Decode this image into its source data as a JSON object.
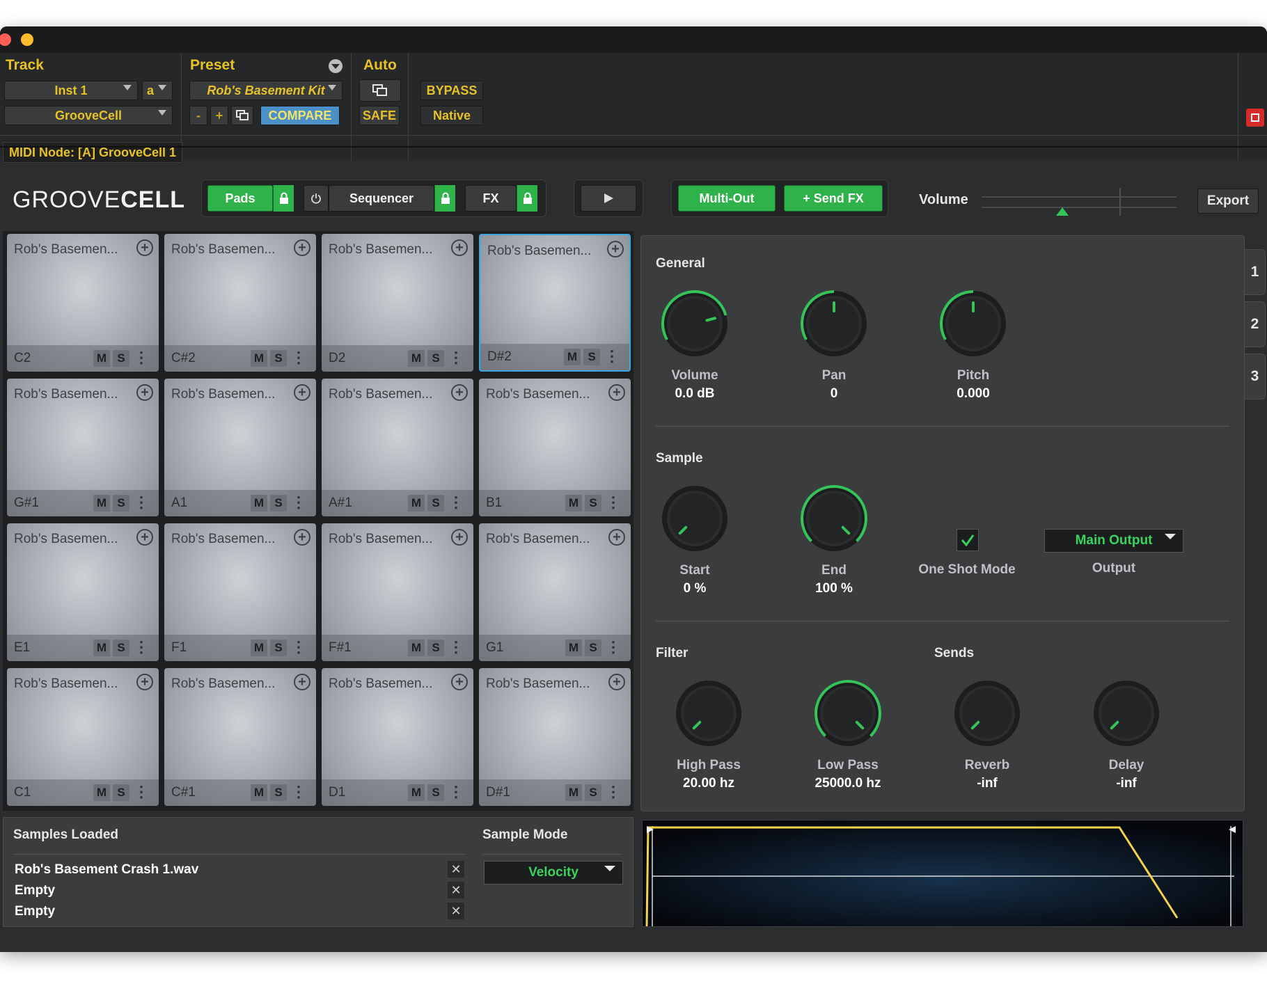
{
  "header": {
    "track_label": "Track",
    "preset_label": "Preset",
    "auto_label": "Auto",
    "track_select": "Inst 1",
    "track_channel": "a",
    "insert_select": "GrooveCell",
    "preset_select": "Rob's Basement Kit",
    "minus": "-",
    "plus": "+",
    "compare": "COMPARE",
    "safe": "SAFE",
    "bypass": "BYPASS",
    "native": "Native",
    "midi_node": "MIDI Node: [A] GrooveCell 1"
  },
  "plugin": {
    "logo_light": "GROOVE",
    "logo_bold": "CELL",
    "tabs": {
      "pads": "Pads",
      "sequencer": "Sequencer",
      "fx": "FX"
    },
    "multi_out": "Multi-Out",
    "send_fx": "+ Send FX",
    "volume_label": "Volume",
    "volume_level": 0.42,
    "export": "Export"
  },
  "pads": [
    {
      "name": "Rob's Basemen...",
      "note": "C2",
      "selected": false
    },
    {
      "name": "Rob's Basemen...",
      "note": "C#2",
      "selected": false
    },
    {
      "name": "Rob's Basemen...",
      "note": "D2",
      "selected": false
    },
    {
      "name": "Rob's Basemen...",
      "note": "D#2",
      "selected": true
    },
    {
      "name": "Rob's Basemen...",
      "note": "G#1",
      "selected": false
    },
    {
      "name": "Rob's Basemen...",
      "note": "A1",
      "selected": false
    },
    {
      "name": "Rob's Basemen...",
      "note": "A#1",
      "selected": false
    },
    {
      "name": "Rob's Basemen...",
      "note": "B1",
      "selected": false
    },
    {
      "name": "Rob's Basemen...",
      "note": "E1",
      "selected": false
    },
    {
      "name": "Rob's Basemen...",
      "note": "F1",
      "selected": false
    },
    {
      "name": "Rob's Basemen...",
      "note": "F#1",
      "selected": false
    },
    {
      "name": "Rob's Basemen...",
      "note": "G1",
      "selected": false
    },
    {
      "name": "Rob's Basemen...",
      "note": "C1",
      "selected": false
    },
    {
      "name": "Rob's Basemen...",
      "note": "C#1",
      "selected": false
    },
    {
      "name": "Rob's Basemen...",
      "note": "D1",
      "selected": false
    },
    {
      "name": "Rob's Basemen...",
      "note": "D#1",
      "selected": false
    }
  ],
  "pad_buttons": {
    "mute": "M",
    "solo": "S"
  },
  "right_tabs": [
    "1",
    "2",
    "3"
  ],
  "general": {
    "title": "General",
    "volume": {
      "label": "Volume",
      "value": "0.0 dB"
    },
    "pan": {
      "label": "Pan",
      "value": "0"
    },
    "pitch": {
      "label": "Pitch",
      "value": "0.000"
    }
  },
  "sample": {
    "title": "Sample",
    "start": {
      "label": "Start",
      "value": "0 %"
    },
    "end": {
      "label": "End",
      "value": "100 %"
    },
    "one_shot": "One Shot Mode",
    "output_select": "Main Output",
    "output_label": "Output"
  },
  "filter": {
    "title": "Filter",
    "high_pass": {
      "label": "High Pass",
      "value": "20.00 hz"
    },
    "low_pass": {
      "label": "Low Pass",
      "value": "25000.0 hz"
    }
  },
  "sends": {
    "title": "Sends",
    "reverb": {
      "label": "Reverb",
      "value": "-inf"
    },
    "delay": {
      "label": "Delay",
      "value": "-inf"
    }
  },
  "samples_loaded": {
    "title": "Samples Loaded",
    "items": [
      "Rob's Basement Crash 1.wav",
      "Empty",
      "Empty"
    ]
  },
  "sample_mode": {
    "title": "Sample Mode",
    "value": "Velocity"
  },
  "colors": {
    "accent_green": "#2fb24a",
    "label_yellow": "#e6c229",
    "selected_pad": "#3aa7e0",
    "knob_arc": "#35c35a"
  }
}
